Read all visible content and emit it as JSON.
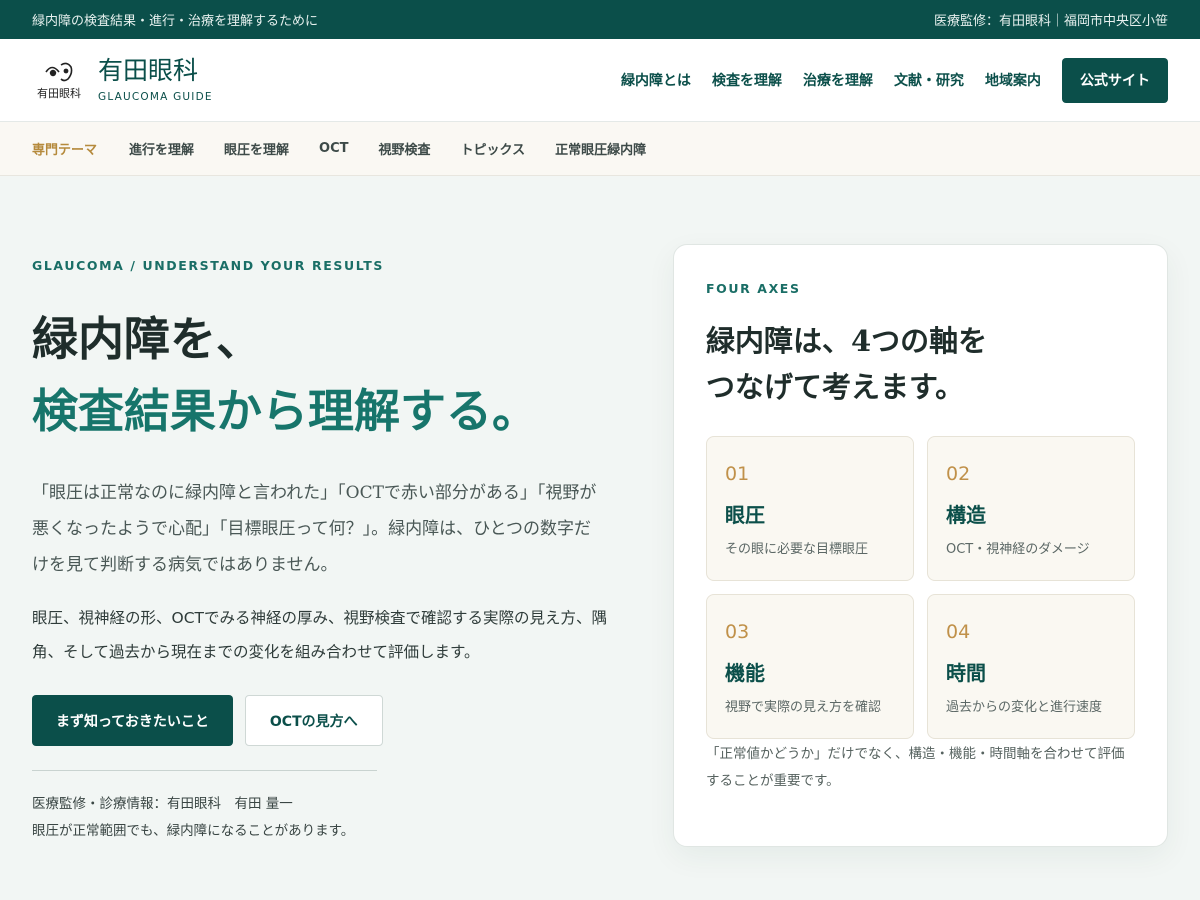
{
  "topbar": {
    "left": "緑内障の検査結果・進行・治療を理解するために",
    "right": "医療監修：有田眼科｜福岡市中央区小笹"
  },
  "header": {
    "logo_text": "有田眼科",
    "brand_name": "有田眼科",
    "brand_sub": "GLAUCOMA GUIDE",
    "nav": [
      "緑内障とは",
      "検査を理解",
      "治療を理解",
      "文献・研究",
      "地域案内"
    ],
    "cta": "公式サイト"
  },
  "subnav": {
    "label": "専門テーマ",
    "items": [
      "進行を理解",
      "眼圧を理解",
      "OCT",
      "視野検査",
      "トピックス",
      "正常眼圧緑内障"
    ]
  },
  "hero": {
    "eyebrow": "GLAUCOMA / UNDERSTAND YOUR RESULTS",
    "title_line1": "緑内障を、",
    "title_line2": "検査結果から理解する。",
    "lead": "「眼圧は正常なのに緑内障と言われた」「OCTで赤い部分がある」「視野が悪くなったようで心配」「目標眼圧って何？」。緑内障は、ひとつの数字だけを見て判断する病気ではありません。",
    "body": "眼圧、視神経の形、OCTでみる神経の厚み、視野検査で確認する実際の見え方、隅角、そして過去から現在までの変化を組み合わせて評価します。",
    "btn_primary": "まず知っておきたいこと",
    "btn_secondary": "OCTの見方へ",
    "meta_line1": "医療監修・診療情報：有田眼科　有田 量一",
    "meta_line2": "眼圧が正常範囲でも、緑内障になることがあります。"
  },
  "card": {
    "eyebrow": "FOUR AXES",
    "title_line1": "緑内障は、4つの軸を",
    "title_line2": "つなげて考えます。",
    "tiles": [
      {
        "num": "01",
        "title": "眼圧",
        "desc": "その眼に必要な目標眼圧"
      },
      {
        "num": "02",
        "title": "構造",
        "desc": "OCT・視神経のダメージ"
      },
      {
        "num": "03",
        "title": "機能",
        "desc": "視野で実際の見え方を確認"
      },
      {
        "num": "04",
        "title": "時間",
        "desc": "過去からの変化と進行速度"
      }
    ],
    "note": "「正常値かどうか」だけでなく、構造・機能・時間軸を合わせて評価することが重要です。"
  },
  "colors": {
    "primary": "#0b4f4a",
    "accent": "#17756b",
    "gold": "#c0914a",
    "background": "#f2f6f4"
  }
}
